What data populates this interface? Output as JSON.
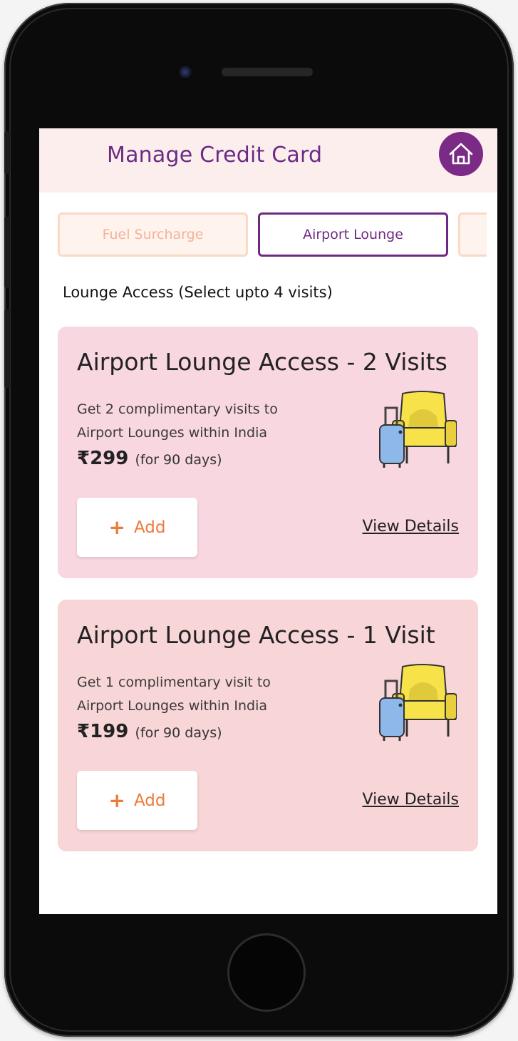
{
  "header": {
    "title": "Manage Credit Card",
    "home_icon": "home-icon"
  },
  "tabs": [
    {
      "label": "Fuel Surcharge",
      "active": false
    },
    {
      "label": "Airport Lounge",
      "active": true
    },
    {
      "label": "",
      "active": false
    }
  ],
  "section": {
    "label": "Lounge Access (Select upto 4 visits)"
  },
  "cards": [
    {
      "title": "Airport Lounge Access - 2 Visits",
      "description": "Get 2 complimentary visits to Airport Lounges within India",
      "price": "₹299",
      "price_note": "(for 90 days)",
      "add_label": "Add",
      "view_details_label": "View Details",
      "illustration": "lounge-chair-luggage-icon",
      "background": "#f8d7e1"
    },
    {
      "title": "Airport Lounge Access - 1 Visit",
      "description": "Get 1 complimentary visit to Airport Lounges within India",
      "price": "₹199",
      "price_note": "(for 90 days)",
      "add_label": "Add",
      "view_details_label": "View Details",
      "illustration": "lounge-chair-luggage-icon",
      "background": "#f8d5d7"
    }
  ],
  "colors": {
    "brand_purple": "#6e2a83",
    "accent_orange": "#ee7a3a",
    "header_bg": "#fdeeee"
  }
}
